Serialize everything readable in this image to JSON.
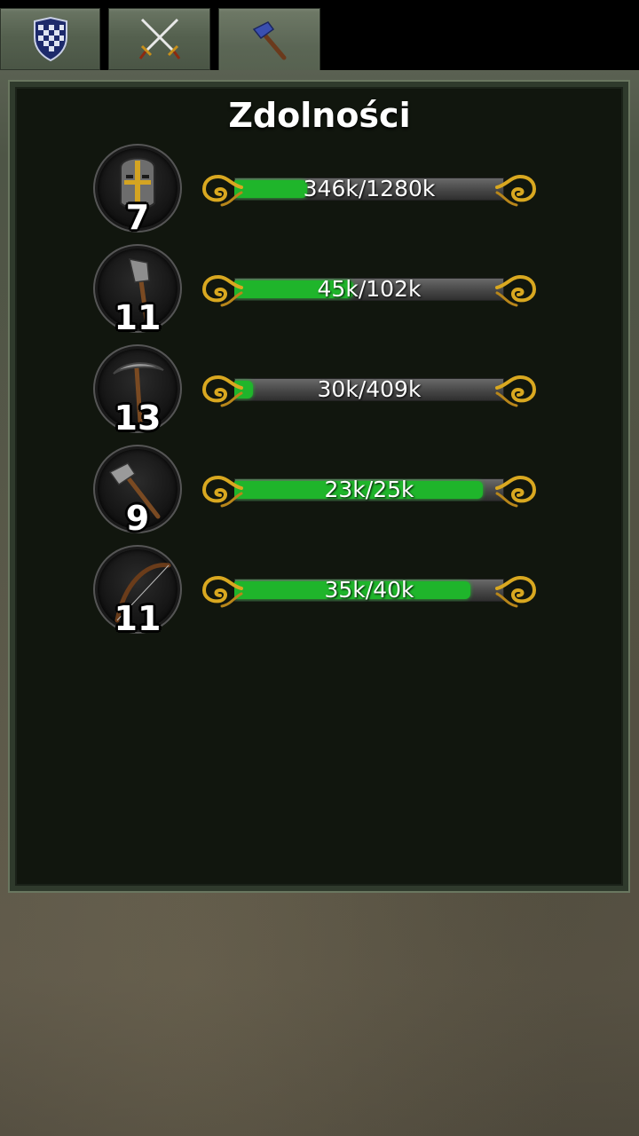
{
  "tabs": [
    {
      "icon": "shield-icon"
    },
    {
      "icon": "crossed-swords-icon"
    },
    {
      "icon": "hammer-icon",
      "active": true
    }
  ],
  "panel": {
    "title": "Zdolności"
  },
  "skills": [
    {
      "icon": "helmet-icon",
      "level": "7",
      "progress_text": "346k/1280k",
      "progress": 0.27
    },
    {
      "icon": "axe-icon",
      "level": "11",
      "progress_text": "45k/102k",
      "progress": 0.44
    },
    {
      "icon": "pickaxe-icon",
      "level": "13",
      "progress_text": "30k/409k",
      "progress": 0.07
    },
    {
      "icon": "hammer-icon",
      "level": "9",
      "progress_text": "23k/25k",
      "progress": 0.92
    },
    {
      "icon": "bow-icon",
      "level": "11",
      "progress_text": "35k/40k",
      "progress": 0.875
    }
  ],
  "colors": {
    "bar_fill": "#1fb52b",
    "ornament_gold": "#d9a820",
    "panel_bg": "#11160e"
  }
}
